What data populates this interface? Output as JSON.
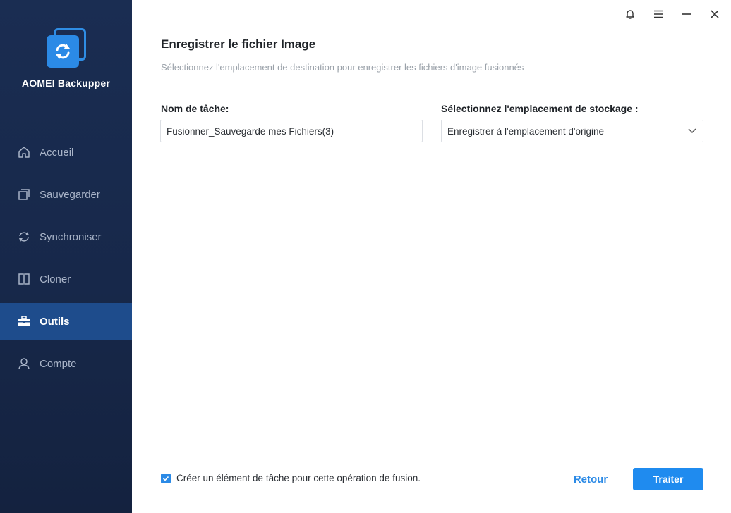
{
  "app": {
    "name": "AOMEI Backupper",
    "accent": "#2b8ae6"
  },
  "sidebar": {
    "items": [
      {
        "label": "Accueil",
        "icon": "home-icon",
        "active": false
      },
      {
        "label": "Sauvegarder",
        "icon": "backup-icon",
        "active": false
      },
      {
        "label": "Synchroniser",
        "icon": "sync-icon",
        "active": false
      },
      {
        "label": "Cloner",
        "icon": "clone-icon",
        "active": false
      },
      {
        "label": "Outils",
        "icon": "toolbox-icon",
        "active": true
      },
      {
        "label": "Compte",
        "icon": "user-icon",
        "active": false
      }
    ]
  },
  "window_controls": [
    "bell-icon",
    "menu-icon",
    "minimize-icon",
    "close-icon"
  ],
  "page": {
    "title": "Enregistrer le fichier Image",
    "subtitle": "Sélectionnez l'emplacement de destination pour enregistrer les fichiers d'image fusionnés"
  },
  "form": {
    "task_name_label": "Nom de tâche:",
    "task_name_value": "Fusionner_Sauvegarde mes Fichiers(3)",
    "storage_label": "Sélectionnez l'emplacement de stockage :",
    "storage_value": "Enregistrer à l'emplacement d'origine"
  },
  "footer": {
    "checkbox_label": "Créer un élément de tâche pour cette opération de fusion.",
    "checkbox_checked": true,
    "back_label": "Retour",
    "process_label": "Traiter"
  }
}
